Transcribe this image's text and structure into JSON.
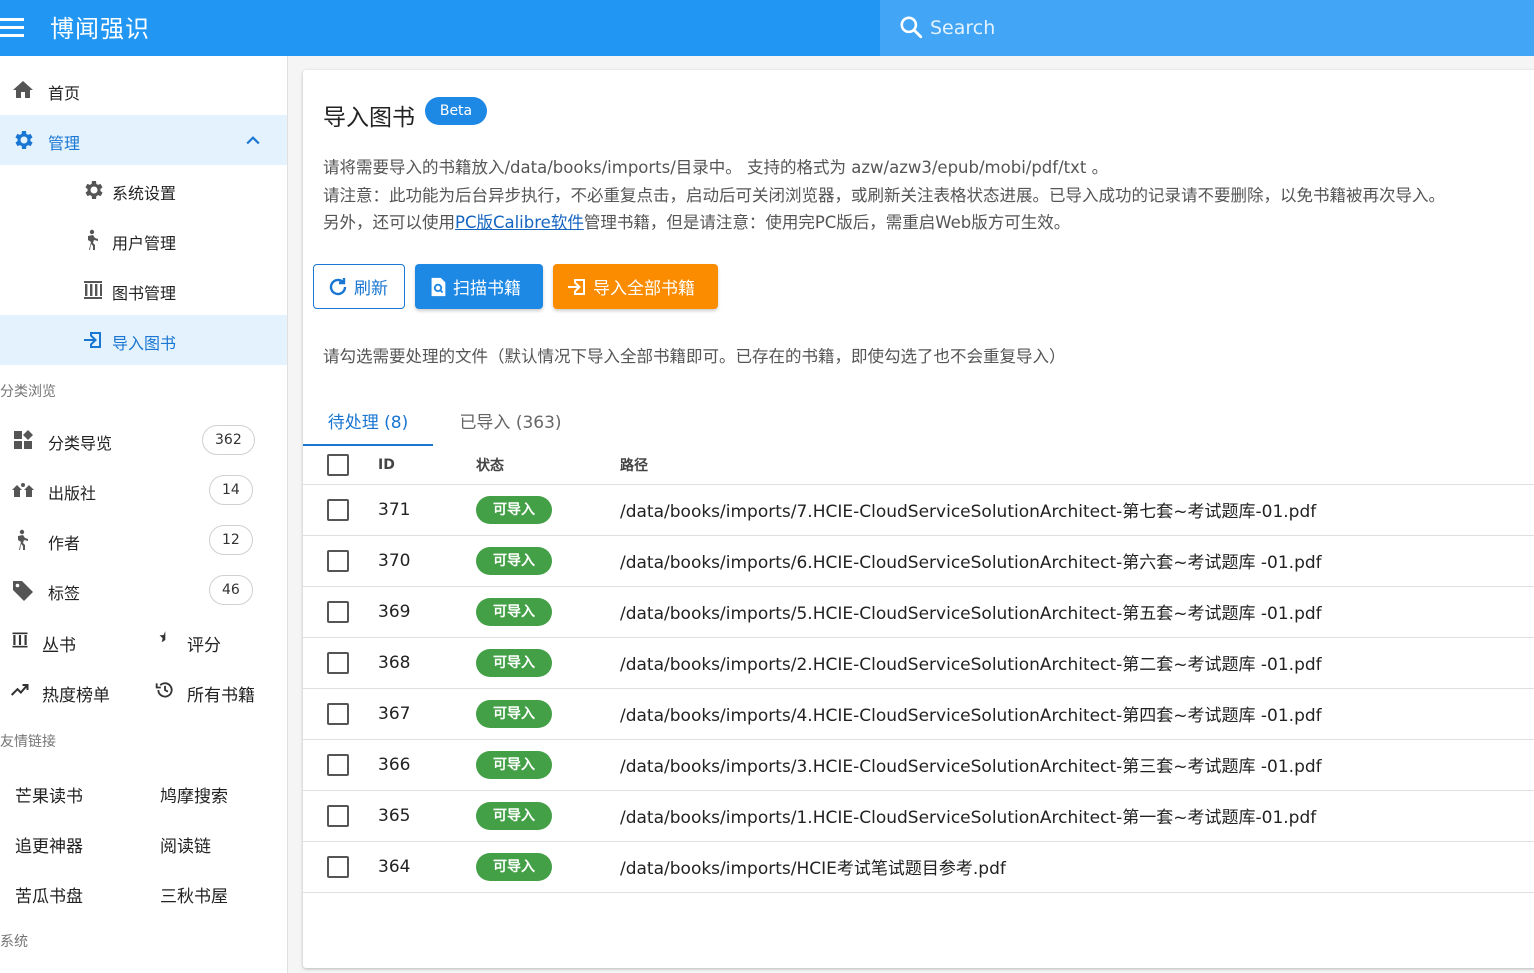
{
  "app": {
    "title": "博闻强识"
  },
  "search": {
    "placeholder": "Search"
  },
  "sidebar": {
    "home": "首页",
    "admin": "管理",
    "admin_items": [
      "系统设置",
      "用户管理",
      "图书管理",
      "导入图书"
    ],
    "section_browse": "分类浏览",
    "browse": [
      {
        "label": "分类导览",
        "count": "362"
      },
      {
        "label": "出版社",
        "count": "14"
      },
      {
        "label": "作者",
        "count": "12"
      },
      {
        "label": "标签",
        "count": "46"
      }
    ],
    "series": "丛书",
    "rating": "评分",
    "hot": "热度榜单",
    "all_books": "所有书籍",
    "section_links": "友情链接",
    "links": [
      "芒果读书",
      "鸠摩搜索",
      "追更神器",
      "阅读链",
      "苦瓜书盘",
      "三秋书屋"
    ],
    "section_system": "系统"
  },
  "main": {
    "title": "导入图书",
    "beta": "Beta",
    "desc1": "请将需要导入的书籍放入/data/books/imports/目录中。 支持的格式为 azw/azw3/epub/mobi/pdf/txt 。",
    "desc2": "请注意：此功能为后台异步执行，不必重复点击，启动后可关闭浏览器，或刷新关注表格状态进展。已导入成功的记录请不要删除，以免书籍被再次导入。",
    "desc3_pre": "另外，还可以使用",
    "desc3_link": "PC版Calibre软件",
    "desc3_post": "管理书籍，但是请注意：使用完PC版后，需重启Web版方可生效。",
    "btn_refresh": "刷新",
    "btn_scan": "扫描书籍",
    "btn_import_all": "导入全部书籍",
    "hint": "请勾选需要处理的文件（默认情况下导入全部书籍即可。已存在的书籍，即使勾选了也不会重复导入）",
    "tab_pending": "待处理 (8)",
    "tab_imported": "已导入 (363)",
    "columns": {
      "id": "ID",
      "status": "状态",
      "path": "路径"
    }
  },
  "rows": [
    {
      "id": "371",
      "status": "可导入",
      "path": "/data/books/imports/7.HCIE-CloudServiceSolutionArchitect-第七套~考试题库-01.pdf"
    },
    {
      "id": "370",
      "status": "可导入",
      "path": "/data/books/imports/6.HCIE-CloudServiceSolutionArchitect-第六套~考试题库 -01.pdf"
    },
    {
      "id": "369",
      "status": "可导入",
      "path": "/data/books/imports/5.HCIE-CloudServiceSolutionArchitect-第五套~考试题库 -01.pdf"
    },
    {
      "id": "368",
      "status": "可导入",
      "path": "/data/books/imports/2.HCIE-CloudServiceSolutionArchitect-第二套~考试题库 -01.pdf"
    },
    {
      "id": "367",
      "status": "可导入",
      "path": "/data/books/imports/4.HCIE-CloudServiceSolutionArchitect-第四套~考试题库 -01.pdf"
    },
    {
      "id": "366",
      "status": "可导入",
      "path": "/data/books/imports/3.HCIE-CloudServiceSolutionArchitect-第三套~考试题库 -01.pdf"
    },
    {
      "id": "365",
      "status": "可导入",
      "path": "/data/books/imports/1.HCIE-CloudServiceSolutionArchitect-第一套~考试题库-01.pdf"
    },
    {
      "id": "364",
      "status": "可导入",
      "path": "/data/books/imports/HCIE考试笔试题目参考.pdf"
    }
  ],
  "colors": {
    "primary": "#2196f3",
    "accent_orange": "#fb8c00",
    "status_green": "#43a047"
  }
}
